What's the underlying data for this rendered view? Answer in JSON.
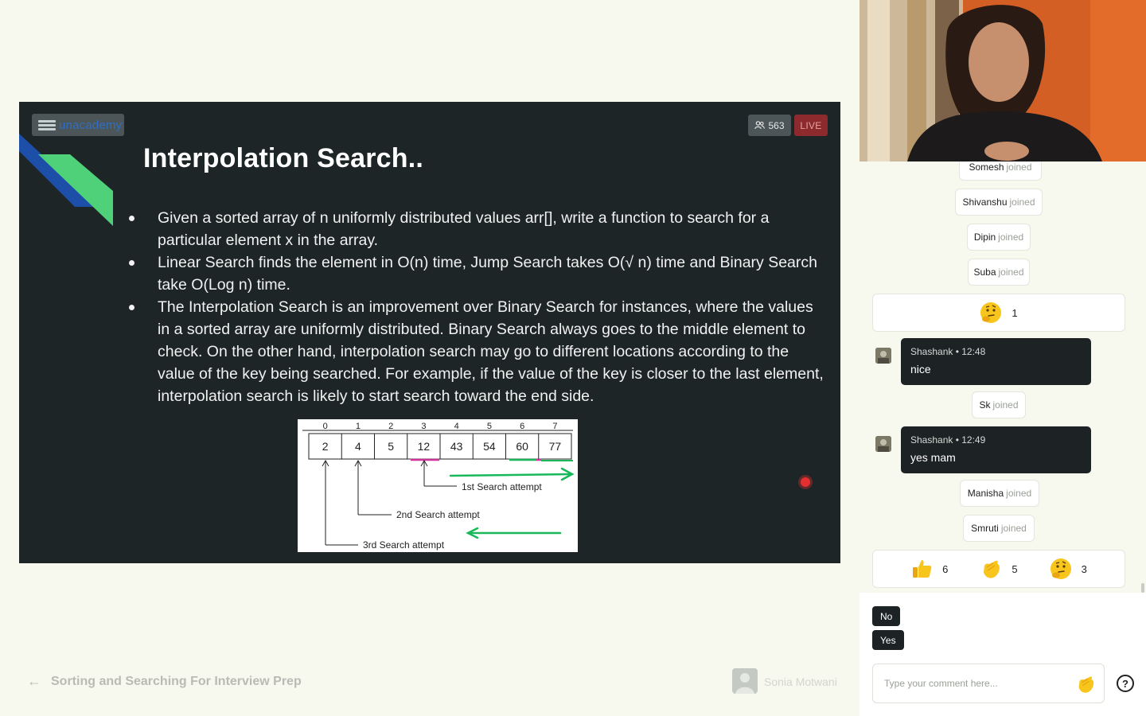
{
  "slide": {
    "brand": "unacademy",
    "viewer_count": "563",
    "live_label": "LIVE",
    "title": "Interpolation Search..",
    "bullets": [
      "Given a sorted array of n uniformly distributed values arr[], write a function to search for a particular element x in the array.",
      "Linear Search finds the element in O(n) time, Jump Search takes O(√ n) time and Binary Search take O(Log n) time.",
      "The Interpolation Search is an improvement over Binary Search for instances, where the values in a sorted array are uniformly distributed. Binary Search always goes to the middle element to check. On the other hand, interpolation search may go to different locations according to the value of the key being searched. For example, if the value of the key is closer to the last element, interpolation search is likely to start search toward the end side."
    ],
    "diagram": {
      "indices": [
        "0",
        "1",
        "2",
        "3",
        "4",
        "5",
        "6",
        "7"
      ],
      "values": [
        "2",
        "4",
        "5",
        "12",
        "43",
        "54",
        "60",
        "77"
      ],
      "attempt_1": "1st Search attempt",
      "attempt_2": "2nd Search attempt",
      "attempt_3": "3rd Search attempt"
    }
  },
  "bottom_bar": {
    "course_title": "Sorting and Searching For Interview Prep",
    "educator_name": "Sonia Motwani"
  },
  "chat": {
    "joined_suffix": "joined",
    "partial_top_name": "Somesh",
    "joined_1": [
      "Shivanshu",
      "Dipin",
      "Suba"
    ],
    "reaction_single": {
      "icon": "thinking-emoji",
      "count": "1"
    },
    "message_1": {
      "author": "Shashank",
      "time": "12:48",
      "meta": "Shashank • 12:48",
      "text": "nice"
    },
    "joined_2": "Sk",
    "message_2": {
      "author": "Shashank",
      "time": "12:49",
      "meta": "Shashank • 12:49",
      "text": "yes mam"
    },
    "joined_3": [
      "Manisha",
      "Smruti"
    ],
    "reactions": [
      {
        "icon": "thumbs-up-emoji",
        "count": "6"
      },
      {
        "icon": "clap-emoji",
        "count": "5"
      },
      {
        "icon": "thinking-emoji",
        "count": "3"
      }
    ]
  },
  "poll": {
    "options": [
      "No",
      "Yes"
    ]
  },
  "comment": {
    "placeholder": "Type your comment here..."
  },
  "colors": {
    "slide_bg": "#1d2527",
    "accent_green": "#4fd17a",
    "accent_blue": "#1e4fa8",
    "live_red": "#8c2a2e",
    "page_bg": "#f7f8ee"
  }
}
